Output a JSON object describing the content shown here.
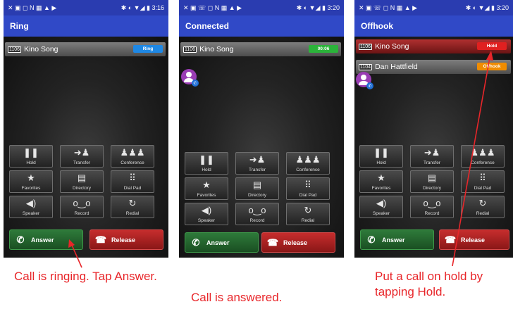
{
  "phones": [
    {
      "time": "3:16",
      "title": "Ring",
      "calls": [
        {
          "ext": "1106",
          "name": "Kino Song",
          "badge": "Ring",
          "row": "grey"
        }
      ],
      "caption": "Call is ringing. Tap Answer."
    },
    {
      "time": "3:20",
      "title": "Connected",
      "calls": [
        {
          "ext": "1106",
          "name": "Kino Song",
          "badge": "00:06",
          "row": "grey"
        }
      ],
      "caption": "Call is answered."
    },
    {
      "time": "3:20",
      "title": "Offhook",
      "calls": [
        {
          "ext": "1106",
          "name": "Kino Song",
          "badge": "Hold",
          "row": "red"
        },
        {
          "ext": "1104",
          "name": "Dan Hattfield",
          "badge": "Offhook",
          "row": "grey"
        }
      ],
      "caption": "Put a call on hold by tapping Hold."
    }
  ],
  "keys": [
    {
      "label": "Hold",
      "icon": "pause-icon"
    },
    {
      "label": "Transfer",
      "icon": "transfer-icon"
    },
    {
      "label": "Conference",
      "icon": "conference-icon"
    },
    {
      "label": "Favorites",
      "icon": "star-icon"
    },
    {
      "label": "Directory",
      "icon": "directory-icon"
    },
    {
      "label": "Dial Pad",
      "icon": "dialpad-icon"
    },
    {
      "label": "Speaker",
      "icon": "speaker-icon"
    },
    {
      "label": "Record",
      "icon": "record-icon"
    },
    {
      "label": "Redial",
      "icon": "redial-icon"
    }
  ],
  "answer_label": "Answer",
  "release_label": "Release",
  "colors": {
    "appbar": "#3049c7",
    "statusbar": "#2a3cb0",
    "badge_ring": "#1e88e5",
    "badge_timer": "#2bb33a",
    "badge_hold": "#e02020",
    "badge_offhook": "#f08c00",
    "caption": "#e8262a",
    "answer": "#2e7a3a",
    "release": "#c62d2d"
  }
}
